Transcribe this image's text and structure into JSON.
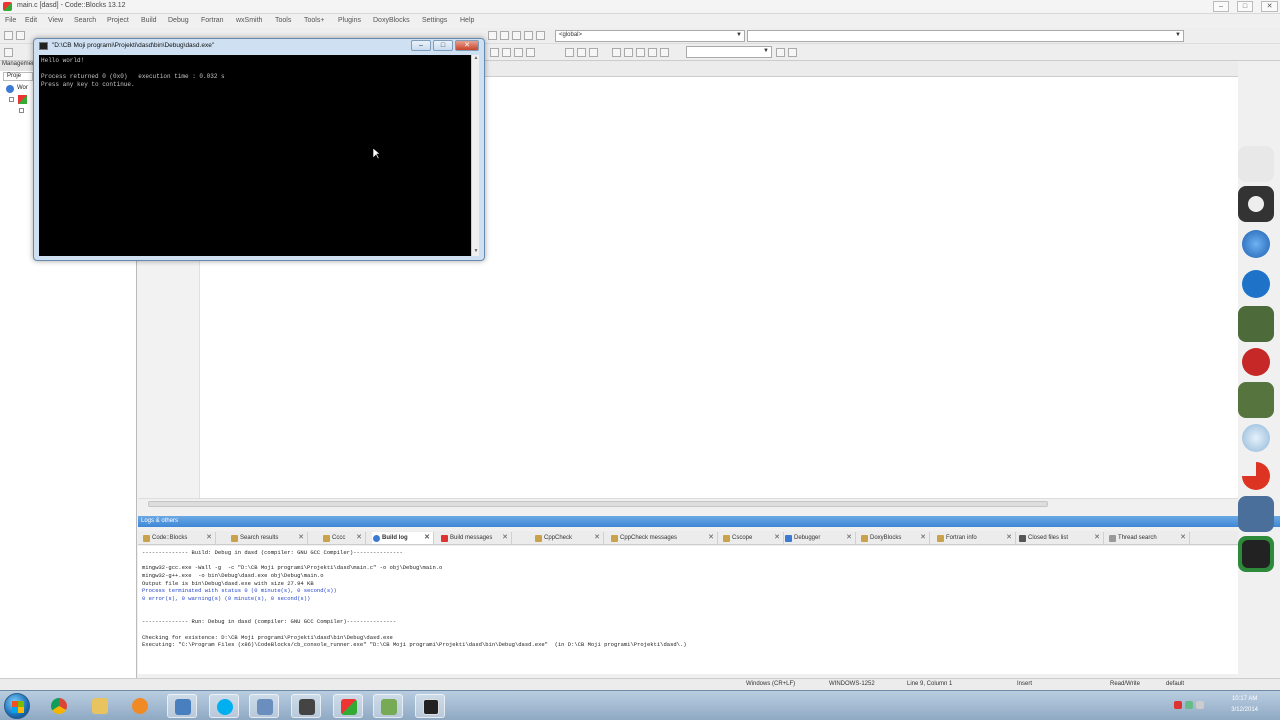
{
  "window": {
    "title": "main.c [dasd] - Code::Blocks 13.12",
    "min_label": "–",
    "max_label": "□",
    "close_label": "✕"
  },
  "menu": [
    "File",
    "Edit",
    "View",
    "Search",
    "Project",
    "Build",
    "Debug",
    "Fortran",
    "wxSmith",
    "Tools",
    "Tools+",
    "Plugins",
    "DoxyBlocks",
    "Settings",
    "Help"
  ],
  "toolbar": {
    "scope_combo": "<global>",
    "function_combo": "",
    "search_combo": ""
  },
  "management": {
    "header": "Management",
    "tab_projects": "Proje",
    "tree_workspace": "Wor"
  },
  "console": {
    "title": "\"D:\\CB Moji programi\\Projekti\\dasd\\bin\\Debug\\dasd.exe\"",
    "lines": [
      "Hello world!",
      "",
      "Process returned 0 (0x0)   execution time : 0.032 s",
      "Press any key to continue."
    ],
    "min_label": "–",
    "max_label": "□",
    "close_label": "✕"
  },
  "logs": {
    "panel_title": "Logs & others",
    "tabs": [
      {
        "label": "Code::Blocks",
        "active": false
      },
      {
        "label": "Search results",
        "active": false
      },
      {
        "label": "Cccc",
        "active": false
      },
      {
        "label": "Build log",
        "active": true
      },
      {
        "label": "Build messages",
        "active": false
      },
      {
        "label": "CppCheck",
        "active": false
      },
      {
        "label": "CppCheck messages",
        "active": false
      },
      {
        "label": "Cscope",
        "active": false
      },
      {
        "label": "Debugger",
        "active": false
      },
      {
        "label": "DoxyBlocks",
        "active": false
      },
      {
        "label": "Fortran info",
        "active": false
      },
      {
        "label": "Closed files list",
        "active": false
      },
      {
        "label": "Thread search",
        "active": false
      }
    ],
    "lines": [
      {
        "text": "-------------- Build: Debug in dasd (compiler: GNU GCC Compiler)---------------",
        "color": "black"
      },
      {
        "text": "",
        "color": "black"
      },
      {
        "text": "mingw32-gcc.exe -Wall -g  -c \"D:\\CB Moji programi\\Projekti\\dasd\\main.c\" -o obj\\Debug\\main.o",
        "color": "black"
      },
      {
        "text": "mingw32-g++.exe  -o bin\\Debug\\dasd.exe obj\\Debug\\main.o",
        "color": "black"
      },
      {
        "text": "Output file is bin\\Debug\\dasd.exe with size 27.94 KB",
        "color": "black"
      },
      {
        "text": "Process terminated with status 0 (0 minute(s), 0 second(s))",
        "color": "blue"
      },
      {
        "text": "0 error(s), 0 warning(s) (0 minute(s), 0 second(s))",
        "color": "blue"
      },
      {
        "text": "",
        "color": "black"
      },
      {
        "text": "",
        "color": "black"
      },
      {
        "text": "-------------- Run: Debug in dasd (compiler: GNU GCC Compiler)---------------",
        "color": "black"
      },
      {
        "text": "",
        "color": "black"
      },
      {
        "text": "Checking for existence: D:\\CB Moji programi\\Projekti\\dasd\\bin\\Debug\\dasd.exe",
        "color": "black"
      },
      {
        "text": "Executing: \"C:\\Program Files (x86)\\CodeBlocks/cb_console_runner.exe\" \"D:\\CB Moji programi\\Projekti\\dasd\\bin\\Debug\\dasd.exe\"  (in D:\\CB Moji programi\\Projekti\\dasd\\.)",
        "color": "black"
      }
    ]
  },
  "statusbar": {
    "eol": "Windows (CR+LF)",
    "encoding": "WINDOWS-1252",
    "position": "Line 9, Column 1",
    "mode": "Insert",
    "access": "Read/Write",
    "profile": "default"
  },
  "taskbar": {
    "time": "10:17 AM",
    "date": "3/12/2014"
  },
  "dock_icons": [
    "printer-icon",
    "settings-icon",
    "lightning-icon",
    "network-icon",
    "terminal-icon",
    "lock-icon",
    "script-icon",
    "globe-icon",
    "ccleaner-icon",
    "monitor-icon",
    "android-icon"
  ]
}
